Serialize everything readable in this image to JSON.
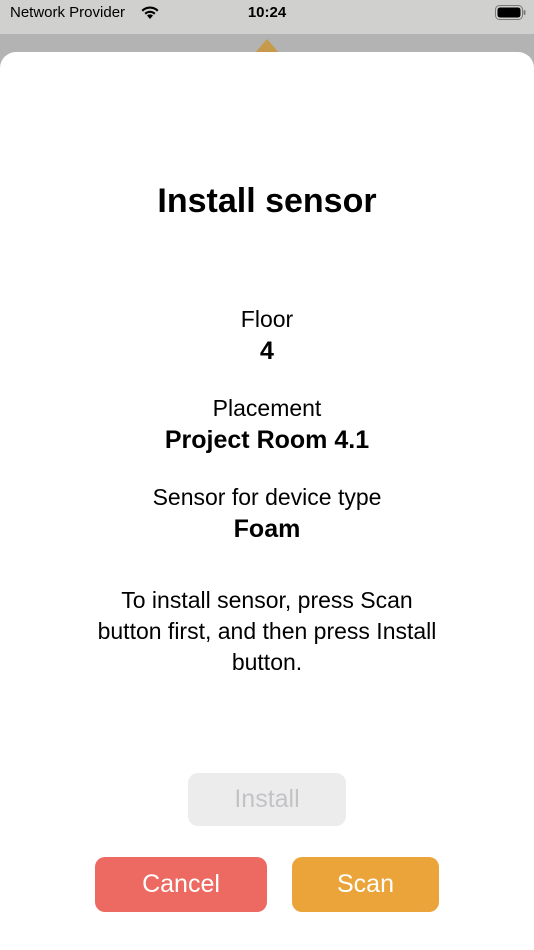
{
  "status_bar": {
    "carrier": "Network Provider",
    "time": "10:24",
    "wifi_icon": "wifi-icon",
    "battery_icon": "battery-icon"
  },
  "sheet": {
    "title": "Install sensor",
    "floor": {
      "label": "Floor",
      "value": "4"
    },
    "placement": {
      "label": "Placement",
      "value": "Project Room 4.1"
    },
    "device_type": {
      "label": "Sensor for device type",
      "value": "Foam"
    },
    "instructions": "To install sensor, press Scan button first, and then press Install button."
  },
  "buttons": {
    "install_label": "Install",
    "install_enabled": false,
    "cancel_label": "Cancel",
    "scan_label": "Scan"
  },
  "colors": {
    "accent": "#eba439",
    "cancel": "#ec6a62",
    "install_disabled_bg": "#ececed",
    "install_disabled_text": "#c3c3c6"
  }
}
